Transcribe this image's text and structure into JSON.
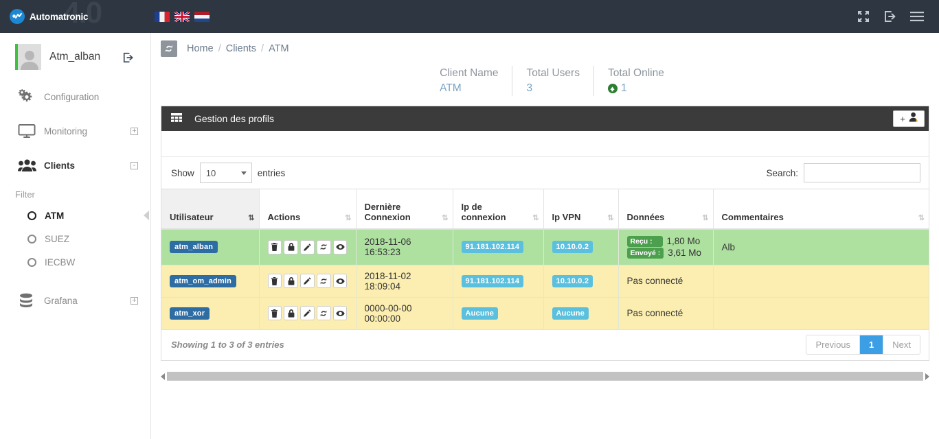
{
  "navbar": {
    "brand_name": "Automatronic",
    "watermark": "4.0",
    "logo_icon": "automatronic-circle-icon",
    "flags": [
      {
        "name": "flag-france",
        "label": "Français"
      },
      {
        "name": "flag-uk",
        "label": "English"
      },
      {
        "name": "flag-netherlands",
        "label": "Nederlands"
      }
    ],
    "icons": [
      {
        "name": "fullscreen-icon"
      },
      {
        "name": "logout-icon"
      },
      {
        "name": "hamburger-menu-icon"
      }
    ]
  },
  "sidebar": {
    "user": {
      "name": "Atm_alban",
      "logout_icon": "logout-icon",
      "status_color": "#3ec13e"
    },
    "menu": [
      {
        "label": "Configuration",
        "icon": "gears-icon",
        "expand": "",
        "active": false
      },
      {
        "label": "Monitoring",
        "icon": "monitor-icon",
        "expand": "+",
        "active": false
      },
      {
        "label": "Clients",
        "icon": "users-group-icon",
        "expand": "-",
        "active": true
      }
    ],
    "filter_label": "Filter",
    "filters": [
      {
        "label": "ATM",
        "active": true
      },
      {
        "label": "SUEZ",
        "active": false
      },
      {
        "label": "IECBW",
        "active": false
      }
    ],
    "grafana": {
      "label": "Grafana",
      "icon": "database-icon",
      "expand": "+"
    }
  },
  "breadcrumb": {
    "refresh_icon": "refresh-icon",
    "items": [
      "Home",
      "Clients",
      "ATM"
    ],
    "separator": "/"
  },
  "stats": [
    {
      "label": "Client Name",
      "value": "ATM",
      "icon": ""
    },
    {
      "label": "Total Users",
      "value": "3",
      "icon": ""
    },
    {
      "label": "Total Online",
      "value": "1",
      "icon": "arrow-up-circle-icon"
    }
  ],
  "panel": {
    "title": "Gestion des profils",
    "grid_icon": "table-grid-icon",
    "add_button": {
      "plus": "+",
      "icon": "add-user-icon"
    }
  },
  "table_controls": {
    "show_label": "Show",
    "entries_value": "10",
    "entries_label": "entries",
    "search_label": "Search:",
    "search_value": "",
    "search_placeholder": ""
  },
  "table": {
    "columns": [
      {
        "label": "Utilisateur",
        "sorted": true
      },
      {
        "label": "Actions",
        "sorted": false
      },
      {
        "label": "Dernière Connexion",
        "sorted": false
      },
      {
        "label": "Ip de connexion",
        "sorted": false
      },
      {
        "label": "Ip VPN",
        "sorted": false
      },
      {
        "label": "Données",
        "sorted": false
      },
      {
        "label": "Commentaires",
        "sorted": false
      }
    ],
    "action_icons": [
      "trash-icon",
      "lock-icon",
      "pencil-icon",
      "refresh-icon",
      "eye-icon"
    ],
    "rows": [
      {
        "user": "atm_alban",
        "last_connection": "2018-11-06 16:53:23",
        "ip_connection": "91.181.102.114",
        "ip_vpn": "10.10.0.2",
        "data_connected": true,
        "data_received_label": "Reçu :",
        "data_received_value": "1,80 Mo",
        "data_sent_label": "Envoyé :",
        "data_sent_value": "3,61 Mo",
        "data_text": "",
        "comment": "Alb",
        "state": "online"
      },
      {
        "user": "atm_om_admin",
        "last_connection": "2018-11-02 18:09:04",
        "ip_connection": "91.181.102.114",
        "ip_vpn": "10.10.0.2",
        "data_connected": false,
        "data_received_label": "",
        "data_received_value": "",
        "data_sent_label": "",
        "data_sent_value": "",
        "data_text": "Pas connecté",
        "comment": "",
        "state": "offline"
      },
      {
        "user": "atm_xor",
        "last_connection": "0000-00-00 00:00:00",
        "ip_connection": "Aucune",
        "ip_vpn": "Aucune",
        "data_connected": false,
        "data_received_label": "",
        "data_received_value": "",
        "data_sent_label": "",
        "data_sent_value": "",
        "data_text": "Pas connecté",
        "comment": "",
        "state": "offline"
      }
    ]
  },
  "table_footer": {
    "showing": "Showing 1 to 3 of 3 entries",
    "pagination": [
      {
        "label": "Previous",
        "active": false
      },
      {
        "label": "1",
        "active": true
      },
      {
        "label": "Next",
        "active": false
      }
    ]
  },
  "colors": {
    "navbar_bg": "#2e3641",
    "panel_head_bg": "#3b3b3b",
    "row_online": "#aee1a0",
    "row_offline": "#fbeeb0",
    "badge_user": "#2e6da4",
    "badge_ip": "#5bc0de",
    "badge_data": "#4c9f4c",
    "pagination_active": "#3c9ee5",
    "status_green": "#3ec13e"
  }
}
